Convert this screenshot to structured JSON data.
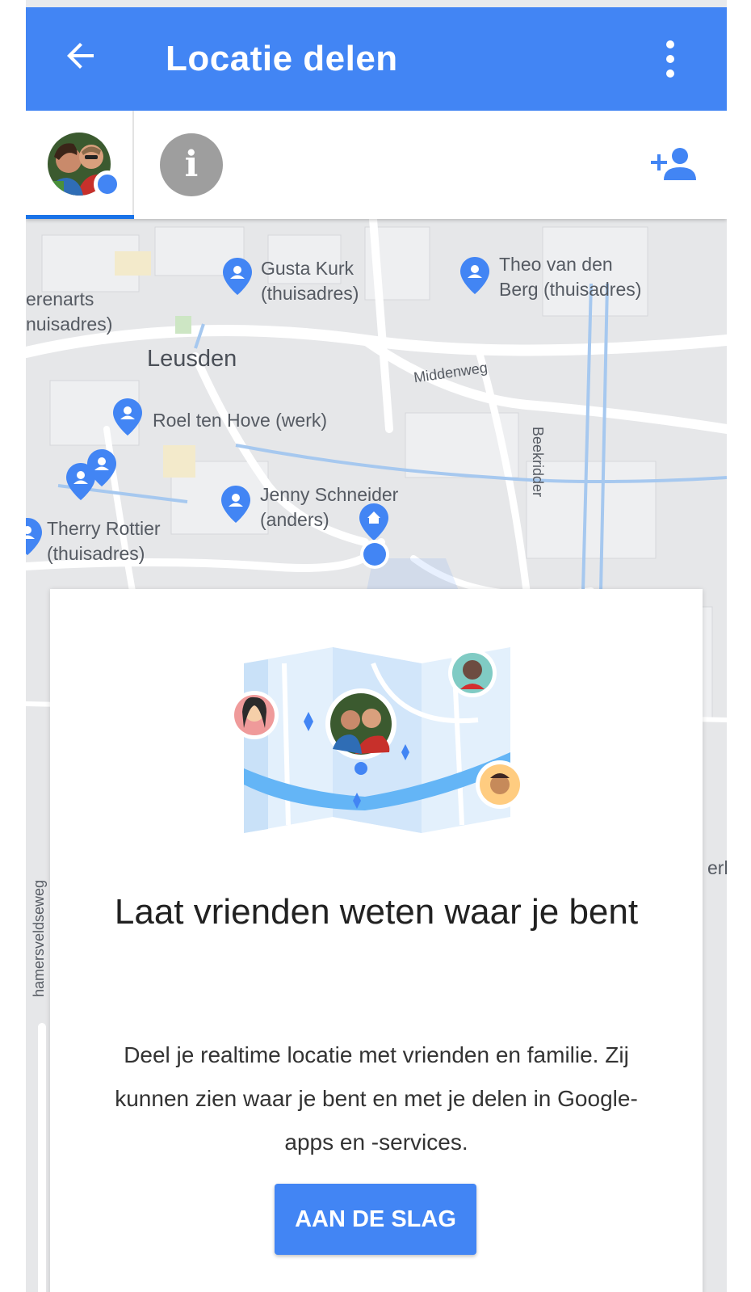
{
  "app_bar": {
    "title": "Locatie delen",
    "color": "#4285f4",
    "back_icon": "arrow-left-icon",
    "menu_icon": "more-vert-icon"
  },
  "tabs": {
    "me_avatar_icon": "profile-photo-avatar",
    "info_glyph": "i",
    "add_person_icon": "person-add-icon"
  },
  "map": {
    "place_labels": [
      {
        "line1": "Gusta Kurk",
        "line2": "(thuisadres)"
      },
      {
        "line1": "Theo van den",
        "line2": "Berg (thuisadres)"
      },
      {
        "line1": "erenarts",
        "line2": "nuisadres)"
      },
      {
        "line1": "Roel ten Hove (werk)",
        "line2": ""
      },
      {
        "line1": "Jenny Schneider",
        "line2": "(anders)"
      },
      {
        "line1": "Therry Rottier",
        "line2": "(thuisadres)"
      }
    ],
    "city": "Leusden",
    "roads": {
      "middenweg": "Middenweg",
      "beekridder": "Beekridder",
      "west_road": "hamersveldseweg",
      "edge_fragment": "erl"
    }
  },
  "card": {
    "title": "Laat vrienden weten waar je bent",
    "body": "Deel je realtime locatie met vrienden en familie. Zij kunnen zien waar je bent en met je delen in Google-apps en -services.",
    "cta_label": "AAN DE SLAG"
  }
}
